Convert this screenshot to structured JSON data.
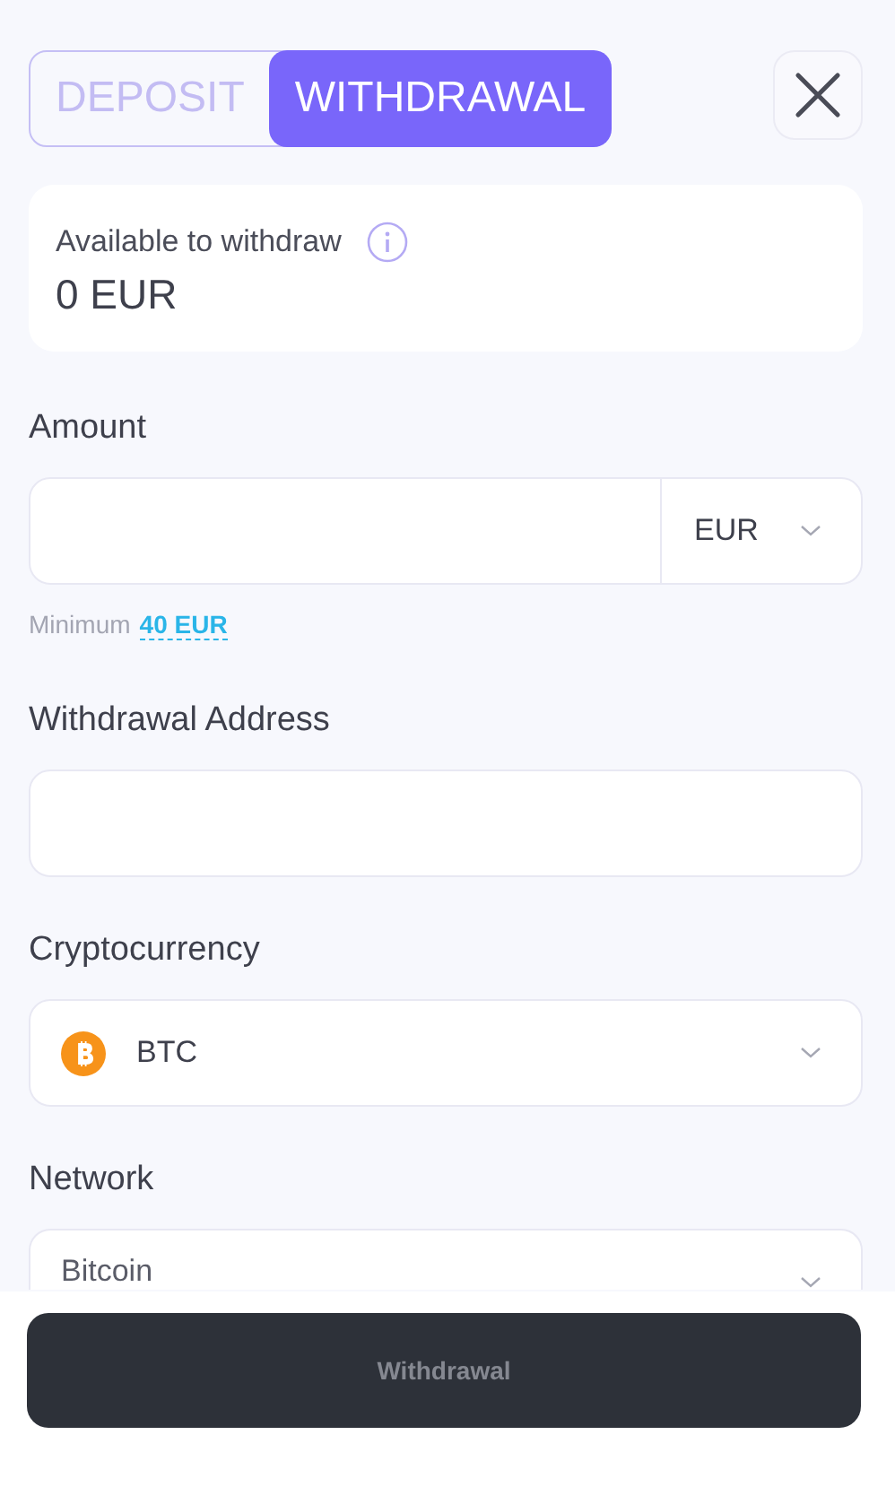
{
  "tabs": [
    {
      "label": "DEPOSIT",
      "selected": false
    },
    {
      "label": "WITHDRAWAL",
      "selected": true
    }
  ],
  "balance": {
    "label": "Available to withdraw",
    "value": "0 EUR"
  },
  "amount": {
    "label": "Amount",
    "currency": "EUR",
    "minimum_label": "Minimum",
    "minimum_value": "40 EUR"
  },
  "address": {
    "label": "Withdrawal Address"
  },
  "cryptocurrency": {
    "label": "Cryptocurrency",
    "value": "BTC"
  },
  "network": {
    "label": "Network",
    "value": "Bitcoin"
  },
  "submit": {
    "label": "Withdrawal",
    "disabled": true
  }
}
